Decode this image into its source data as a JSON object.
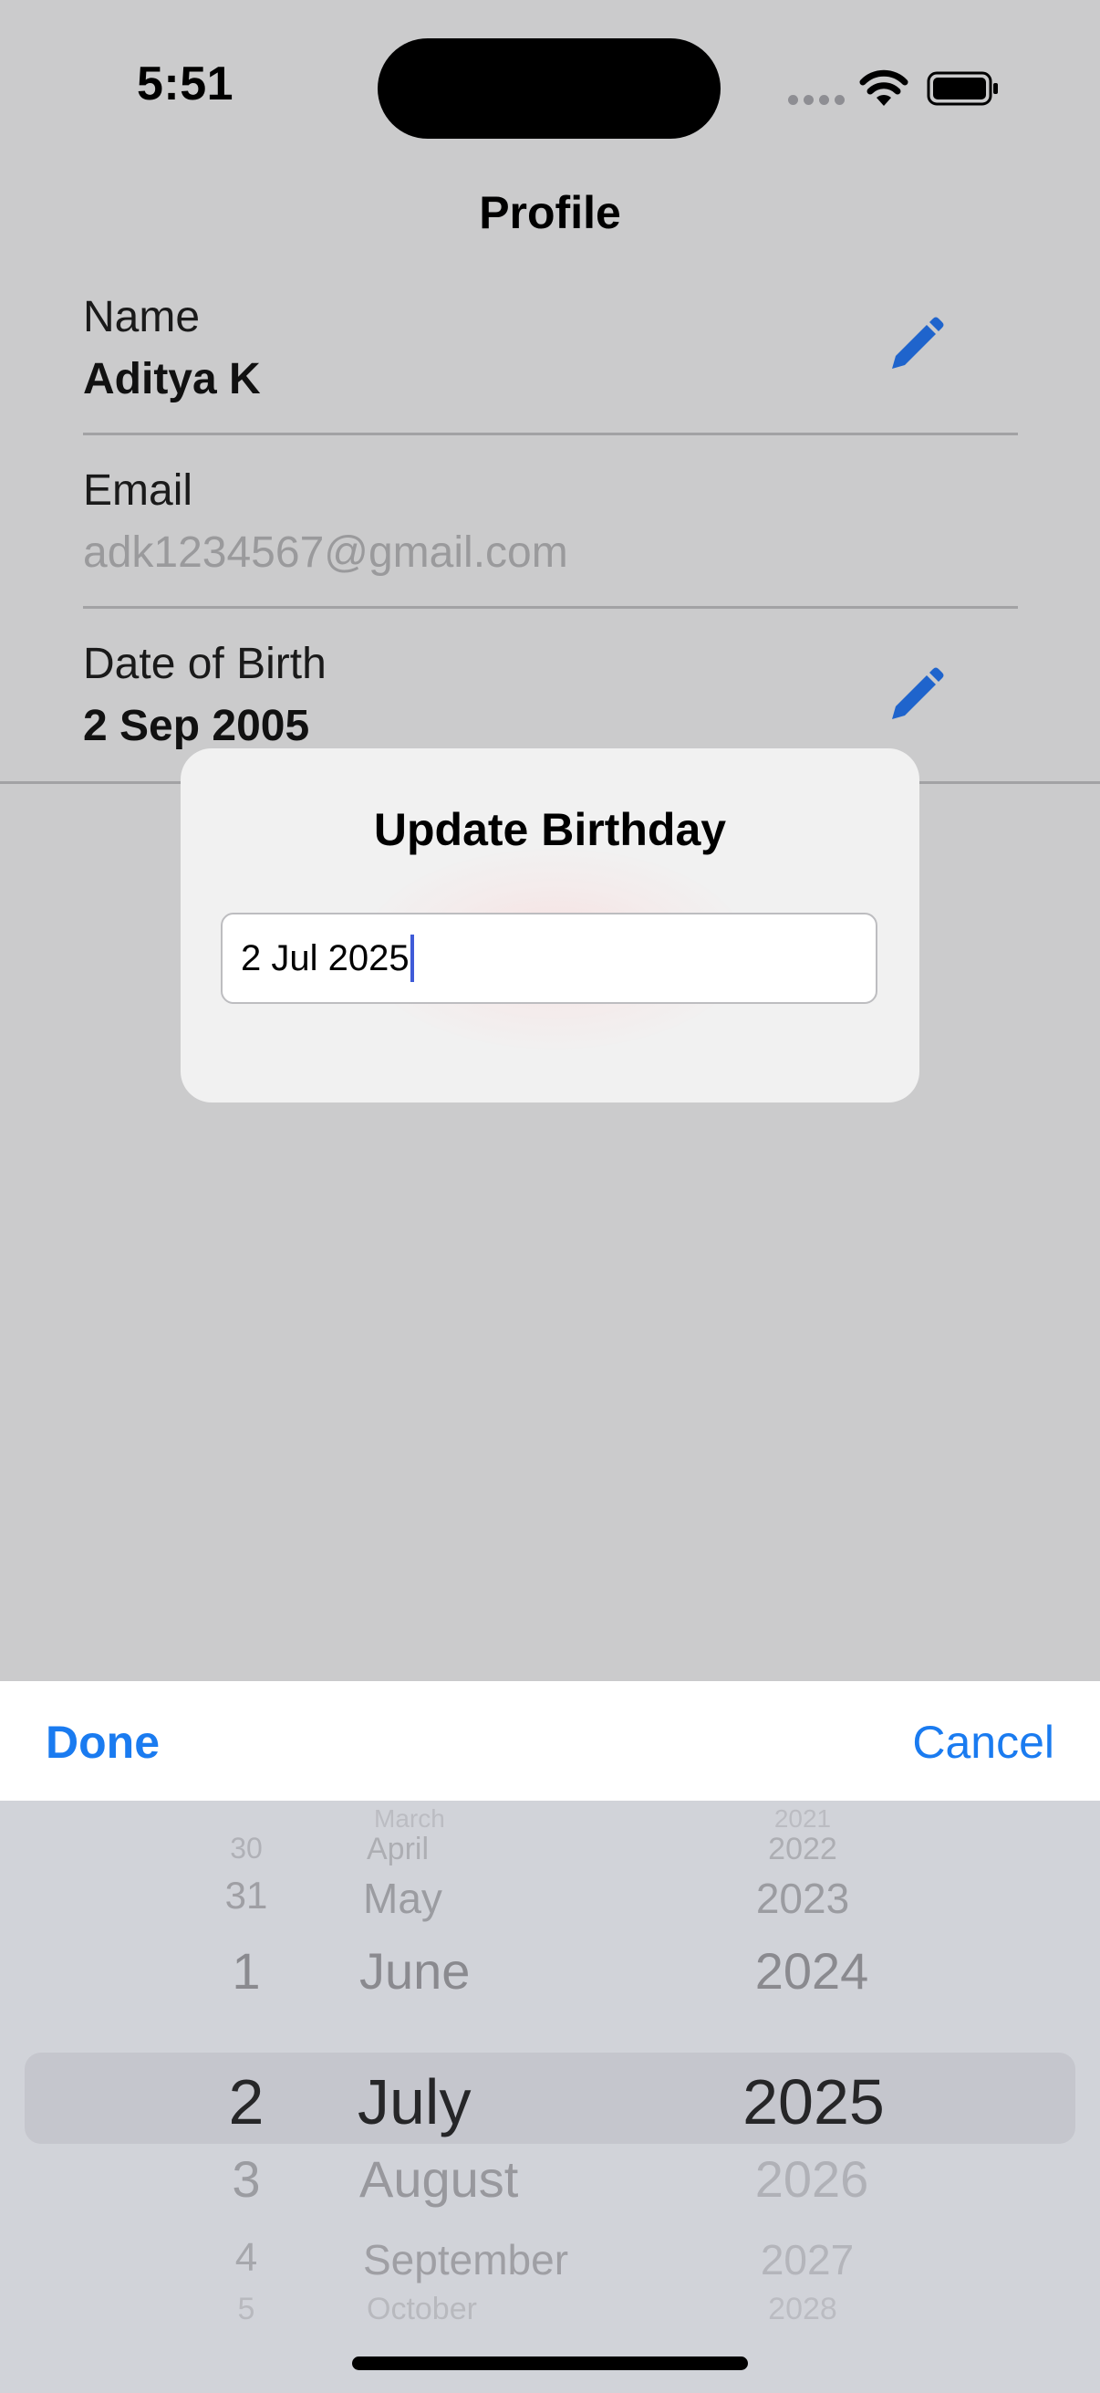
{
  "status_bar": {
    "time": "5:51"
  },
  "header": {
    "title": "Profile"
  },
  "profile": {
    "name_label": "Name",
    "name_value": "Aditya K",
    "email_label": "Email",
    "email_value": "adk1234567@gmail.com",
    "dob_label": "Date of Birth",
    "dob_value": "2 Sep 2005"
  },
  "dialog": {
    "title": "Update Birthday",
    "input_value": "2 Jul 2025"
  },
  "toolbar": {
    "done_label": "Done",
    "cancel_label": "Cancel"
  },
  "picker": {
    "days": [
      "30",
      "31",
      "1",
      "2",
      "3",
      "4",
      "5"
    ],
    "months": [
      "March",
      "April",
      "May",
      "June",
      "July",
      "August",
      "September",
      "October"
    ],
    "years": [
      "2021",
      "2022",
      "2023",
      "2024",
      "2025",
      "2026",
      "2027",
      "2028"
    ],
    "selected": {
      "day": "2",
      "month": "July",
      "year": "2025"
    }
  },
  "colors": {
    "accent": "#1a7bf0",
    "edit_icon": "#1f64cc",
    "caret": "#3f5bd8"
  },
  "icons": [
    "wifi-icon",
    "battery-icon",
    "pencil-icon"
  ]
}
